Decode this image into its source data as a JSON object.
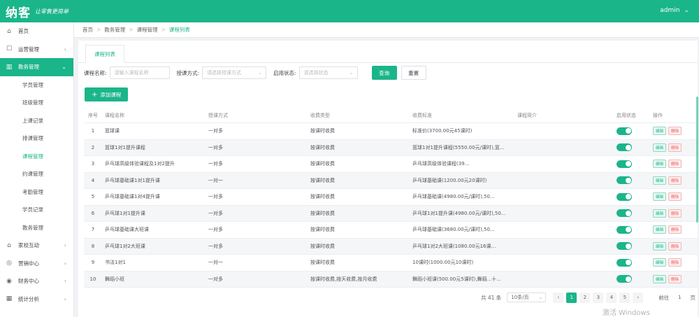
{
  "header": {
    "logo": "纳客",
    "slogan": "让零售更简单",
    "user": "admin"
  },
  "sidebar": {
    "items": [
      {
        "label": "首页",
        "icon": "home-icon"
      },
      {
        "label": "运营管理",
        "icon": "operation-icon"
      },
      {
        "label": "教务管理",
        "icon": "book-icon"
      }
    ],
    "sub_items": [
      "学员管理",
      "班级管理",
      "上课记录",
      "排课管理",
      "课程管理",
      "约课管理",
      "考勤管理",
      "学员记录",
      "教务管理"
    ],
    "items_bottom": [
      {
        "label": "家校互动",
        "icon": "home-school-icon"
      },
      {
        "label": "营销中心",
        "icon": "marketing-icon"
      },
      {
        "label": "财务中心",
        "icon": "finance-icon"
      },
      {
        "label": "统计分析",
        "icon": "stats-icon"
      }
    ]
  },
  "breadcrumb": [
    "首页",
    "教务管理",
    "课程管理",
    "课程列表"
  ],
  "tab_label": "课程列表",
  "filters": {
    "name_label": "课程名称:",
    "name_placeholder": "请输入课程名称",
    "mode_label": "授课方式:",
    "mode_placeholder": "请选择授课方式",
    "status_label": "启用状态:",
    "status_placeholder": "请选择状态",
    "search_btn": "查询",
    "reset_btn": "重置"
  },
  "add_btn": "添加课程",
  "table": {
    "headers": [
      "序号",
      "课程名称",
      "授课方式",
      "收费类型",
      "收费标准",
      "课程简介",
      "启用状态",
      "操作"
    ],
    "edit_label": "编辑",
    "delete_label": "删除",
    "rows": [
      [
        "1",
        "篮球课",
        "一对多",
        "按课时收费",
        "标准价(3700.00元45课时)",
        ""
      ],
      [
        "2",
        "篮球1对1提升课程",
        "一对多",
        "按课时收费",
        "篮球1对1提升课程(5550.00元/课时),篮...",
        ""
      ],
      [
        "3",
        "乒乓球高级体验课程及1对2提升",
        "一对多",
        "按课时收费",
        "乒乓球高级体验课程(39...",
        ""
      ],
      [
        "4",
        "乒乓球基础课1对1提升课",
        "一对一",
        "按课时收费",
        "乒乓球基础课(1200.00元20课时)",
        ""
      ],
      [
        "5",
        "乒乓球基础课1对4提升课",
        "一对多",
        "按课时收费",
        "乒乓球基础课(4980.00元/课时),50...",
        ""
      ],
      [
        "6",
        "乒乓球1对1提升课",
        "一对多",
        "按课时收费",
        "乒乓球1对1提升课(4980.00元/课时),50...",
        ""
      ],
      [
        "7",
        "乒乓球基础课大班课",
        "一对多",
        "按课时收费",
        "乒乓球基础课(3680.00元/课时),50...",
        ""
      ],
      [
        "8",
        "乒乓球1对2大班课",
        "一对多",
        "按课时收费",
        "乒乓球1对2大班课(1080.00元16课...",
        ""
      ],
      [
        "9",
        "书法1对1",
        "一对一",
        "按课时收费",
        "10课时(1000.00元10课时)",
        ""
      ],
      [
        "10",
        "舞蹈小班",
        "一对多",
        "按课时收费,按天收费,按月收费",
        "舞蹈小班课(500.00元5课时),舞蹈...十...",
        ""
      ]
    ]
  },
  "pager": {
    "total": "共 41 条",
    "page_size": "10条/页",
    "pages": [
      "1",
      "2",
      "3",
      "4",
      "5"
    ],
    "prev": "‹",
    "next": "›",
    "goto_label": "前往",
    "goto_value": "1",
    "goto_unit": "页"
  },
  "watermark": "激活 Windows"
}
